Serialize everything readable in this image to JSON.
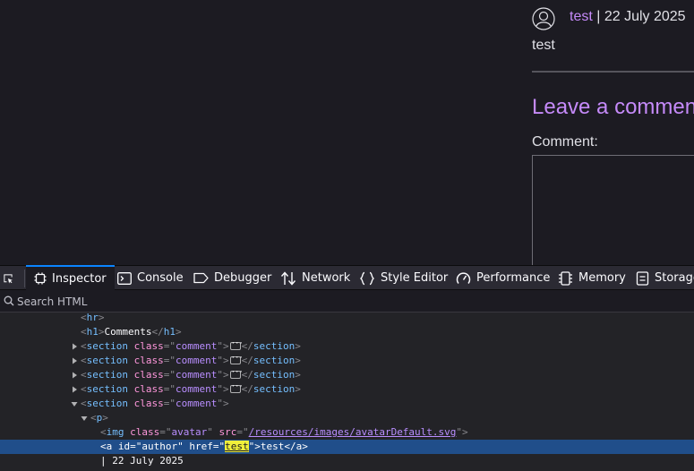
{
  "page": {
    "author_link": "test",
    "date_text": " | 22 July 2025",
    "comment_body": "test",
    "leave_heading": "Leave a comment",
    "comment_label": "Comment:"
  },
  "devtools": {
    "tabs": [
      {
        "label": "Inspector",
        "icon": "inspector-icon",
        "active": true
      },
      {
        "label": "Console",
        "icon": "console-icon"
      },
      {
        "label": "Debugger",
        "icon": "debugger-icon"
      },
      {
        "label": "Network",
        "icon": "network-icon"
      },
      {
        "label": "Style Editor",
        "icon": "style-editor-icon"
      },
      {
        "label": "Performance",
        "icon": "performance-icon"
      },
      {
        "label": "Memory",
        "icon": "memory-icon"
      },
      {
        "label": "Storage",
        "icon": "storage-icon"
      }
    ],
    "search_placeholder": "Search HTML",
    "markup": {
      "hr": "hr",
      "h1_tag": "h1",
      "h1_text": "Comments",
      "section_tag": "section",
      "class_attr": "class",
      "comment_class": "comment",
      "p_tag": "p",
      "img_tag": "img",
      "avatar_class": "avatar",
      "src_attr": "src",
      "src_value": "/resources/images/avatarDefault.svg",
      "a_tag": "a",
      "id_attr": "id",
      "id_value": "author",
      "href_attr": "href",
      "href_value": "test",
      "a_text": "test",
      "date_text": "| 22 July 2025"
    }
  },
  "colors": {
    "accent": "#0a84ff",
    "link_purple": "#c58af9",
    "selection": "#204e8a",
    "search_highlight": "#f0f03a"
  }
}
